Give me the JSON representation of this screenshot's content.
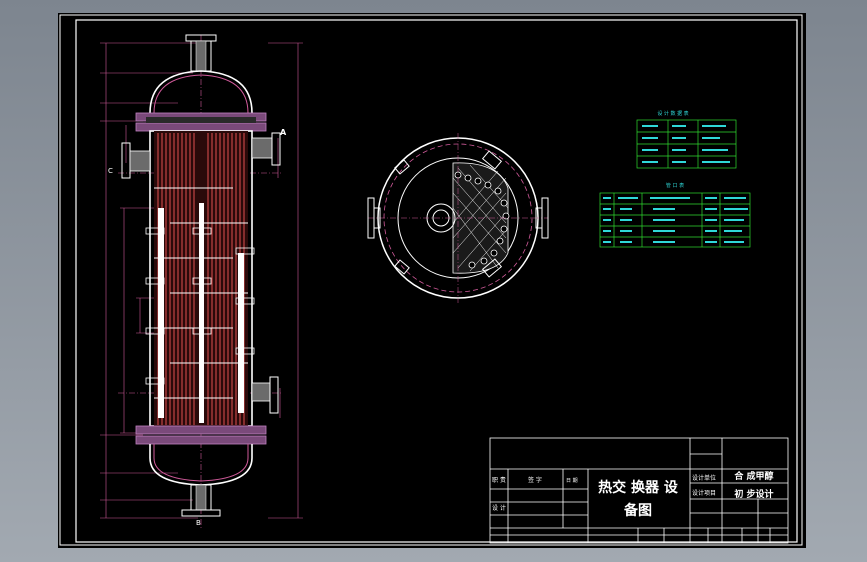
{
  "title_block": {
    "drawing_title_line1": "热交 换器 设",
    "drawing_title_line2": "备图",
    "project_name": "合 成甲醇",
    "stage": "初 步设计",
    "duty_label": "职 责",
    "signature_label": "签 字",
    "date_label": "日 期",
    "design_label": "设 计",
    "design_unit_label": "设计单位",
    "design_item_label": "设计项目"
  },
  "labels": {
    "nozzle_a": "A",
    "nozzle_c": "C",
    "nozzle_b": "B"
  },
  "tables": {
    "design_data_title": "设 计 数 据 表",
    "nozzle_table_title": "管 口 表"
  },
  "colors": {
    "background": "#000000",
    "frame": "#ffffff",
    "tube": "#e05050",
    "dimension": "#d05a9a",
    "table": "#2fdc2f",
    "flange": "#c080c0"
  }
}
